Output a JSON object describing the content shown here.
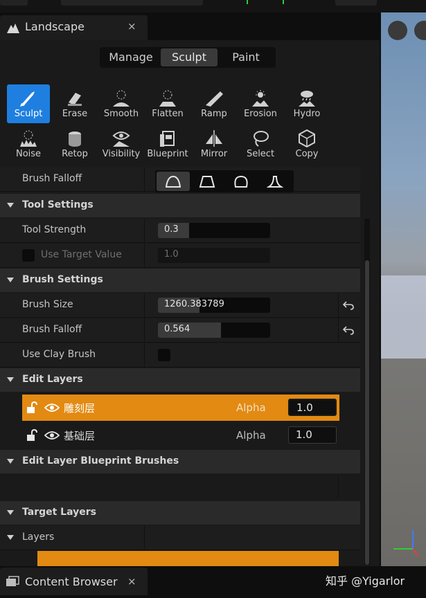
{
  "tab": {
    "title": "Landscape",
    "close": "×"
  },
  "modes": [
    {
      "label": "Manage",
      "active": false
    },
    {
      "label": "Sculpt",
      "active": true
    },
    {
      "label": "Paint",
      "active": false
    }
  ],
  "tools": [
    {
      "label": "Sculpt",
      "icon": "sculpt-brush-icon",
      "active": true
    },
    {
      "label": "Erase",
      "icon": "eraser-icon"
    },
    {
      "label": "Smooth",
      "icon": "smooth-icon"
    },
    {
      "label": "Flatten",
      "icon": "flatten-icon"
    },
    {
      "label": "Ramp",
      "icon": "ramp-icon"
    },
    {
      "label": "Erosion",
      "icon": "erosion-icon"
    },
    {
      "label": "Hydro",
      "icon": "hydro-icon"
    },
    {
      "label": "Noise",
      "icon": "noise-icon"
    },
    {
      "label": "Retop",
      "icon": "retop-icon"
    },
    {
      "label": "Visibility",
      "icon": "visibility-icon"
    },
    {
      "label": "Blueprint",
      "icon": "blueprint-icon"
    },
    {
      "label": "Mirror",
      "icon": "mirror-icon"
    },
    {
      "label": "Select",
      "icon": "select-lasso-icon"
    },
    {
      "label": "Copy",
      "icon": "copy-icon"
    }
  ],
  "brush_falloff_top": {
    "label": "Brush Falloff"
  },
  "tool_settings": {
    "header": "Tool Settings",
    "tool_strength": {
      "label": "Tool Strength",
      "value": "0.3",
      "fraction": 0.28
    },
    "use_target_value": {
      "label": "Use Target Value",
      "value": "1.0"
    }
  },
  "brush_settings": {
    "header": "Brush Settings",
    "brush_size": {
      "label": "Brush Size",
      "value": "1260.383789",
      "fraction": 0.37
    },
    "brush_falloff": {
      "label": "Brush Falloff",
      "value": "0.564",
      "fraction": 0.56
    },
    "use_clay_brush": {
      "label": "Use Clay Brush"
    }
  },
  "edit_layers": {
    "header": "Edit Layers",
    "layers": [
      {
        "name": "雕刻层",
        "alpha_label": "Alpha",
        "alpha": "1.0",
        "selected": true
      },
      {
        "name": "基础层",
        "alpha_label": "Alpha",
        "alpha": "1.0",
        "selected": false
      }
    ]
  },
  "edit_layer_bp": {
    "header": "Edit Layer Blueprint Brushes"
  },
  "target_layers": {
    "header": "Target Layers",
    "layers_label": "Layers"
  },
  "bottom_tab": {
    "title": "Content Browser",
    "close": "×"
  },
  "watermark": "知乎 @Yigarlor",
  "colors": {
    "accent_blue": "#1f7fe0",
    "selection_orange": "#e28a12",
    "panel_bg": "#1a1a1a"
  }
}
